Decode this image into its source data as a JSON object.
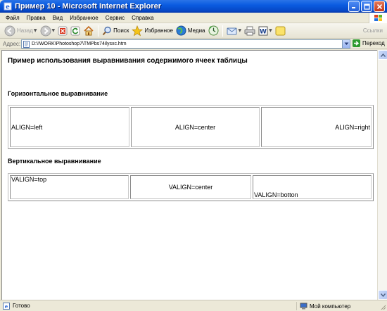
{
  "window": {
    "title": "Пример 10 - Microsoft Internet Explorer",
    "title_bar_color": "#0a5be0"
  },
  "menu": {
    "items": [
      "Файл",
      "Правка",
      "Вид",
      "Избранное",
      "Сервис",
      "Справка"
    ]
  },
  "toolbar": {
    "back_label": "Назад",
    "search_label": "Поиск",
    "favorites_label": "Избранное",
    "media_label": "Медиа",
    "links_label": "Ссылки"
  },
  "address": {
    "label": "Адрес:",
    "value": "D:\\!WORK\\Photoshop7\\TMPbs74ilysxc.htm",
    "go_label": "Переход"
  },
  "page": {
    "heading": "Пример использования выравнивания содержимого ячеек таблицы",
    "horizontal_heading": "Горизонтальное выравнивание",
    "horizontal_cells": [
      "ALIGN=left",
      "ALIGN=center",
      "ALIGN=right"
    ],
    "vertical_heading": "Вертикальное выравнивание",
    "vertical_cells": [
      "VALIGN=top",
      "VALIGN=center",
      "VALIGN=botton"
    ]
  },
  "status": {
    "text": "Готово",
    "zone": "Мой компьютер"
  }
}
